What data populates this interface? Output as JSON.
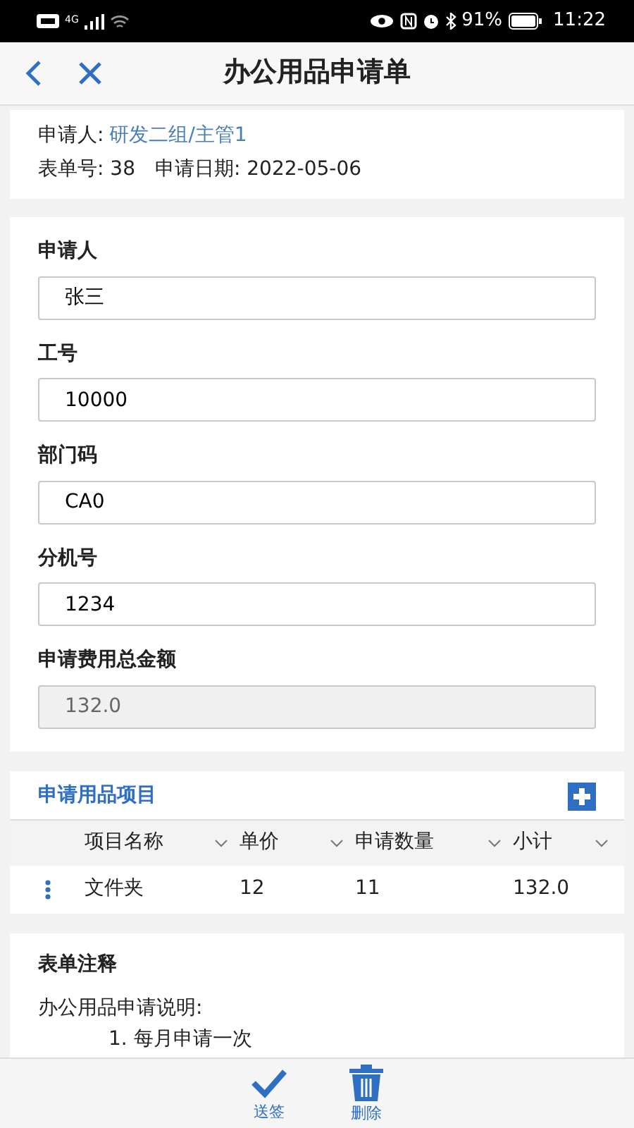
{
  "status_bar": {
    "network": "4G",
    "battery": "91%",
    "time": "11:22"
  },
  "header": {
    "title": "办公用品申请单"
  },
  "summary": {
    "applicant_label": "申请人:",
    "applicant": "研发二组/主管1",
    "form_no": "表单号: 38",
    "date": "申请日期: 2022-05-06"
  },
  "fields": [
    {
      "label": "申请人",
      "value": "张三",
      "disabled": false
    },
    {
      "label": "工号",
      "value": "10000",
      "disabled": false
    },
    {
      "label": "部门码",
      "value": "CA0",
      "disabled": false
    },
    {
      "label": "分机号",
      "value": "1234",
      "disabled": false
    },
    {
      "label": "申请费用总金额",
      "value": "132.0",
      "disabled": true
    }
  ],
  "items_section": {
    "title": "申请用品项目",
    "columns": [
      "项目名称",
      "单价",
      "申请数量",
      "小计"
    ],
    "rows": [
      [
        "文件夹",
        "12",
        "11",
        "132.0"
      ]
    ]
  },
  "notes": {
    "title": "表单注释",
    "lines": [
      "办公用品申请说明:",
      "1. 每月申请一次"
    ]
  },
  "actions": [
    {
      "label": "送签",
      "kind": "check"
    },
    {
      "label": "删除",
      "kind": "trash"
    }
  ]
}
